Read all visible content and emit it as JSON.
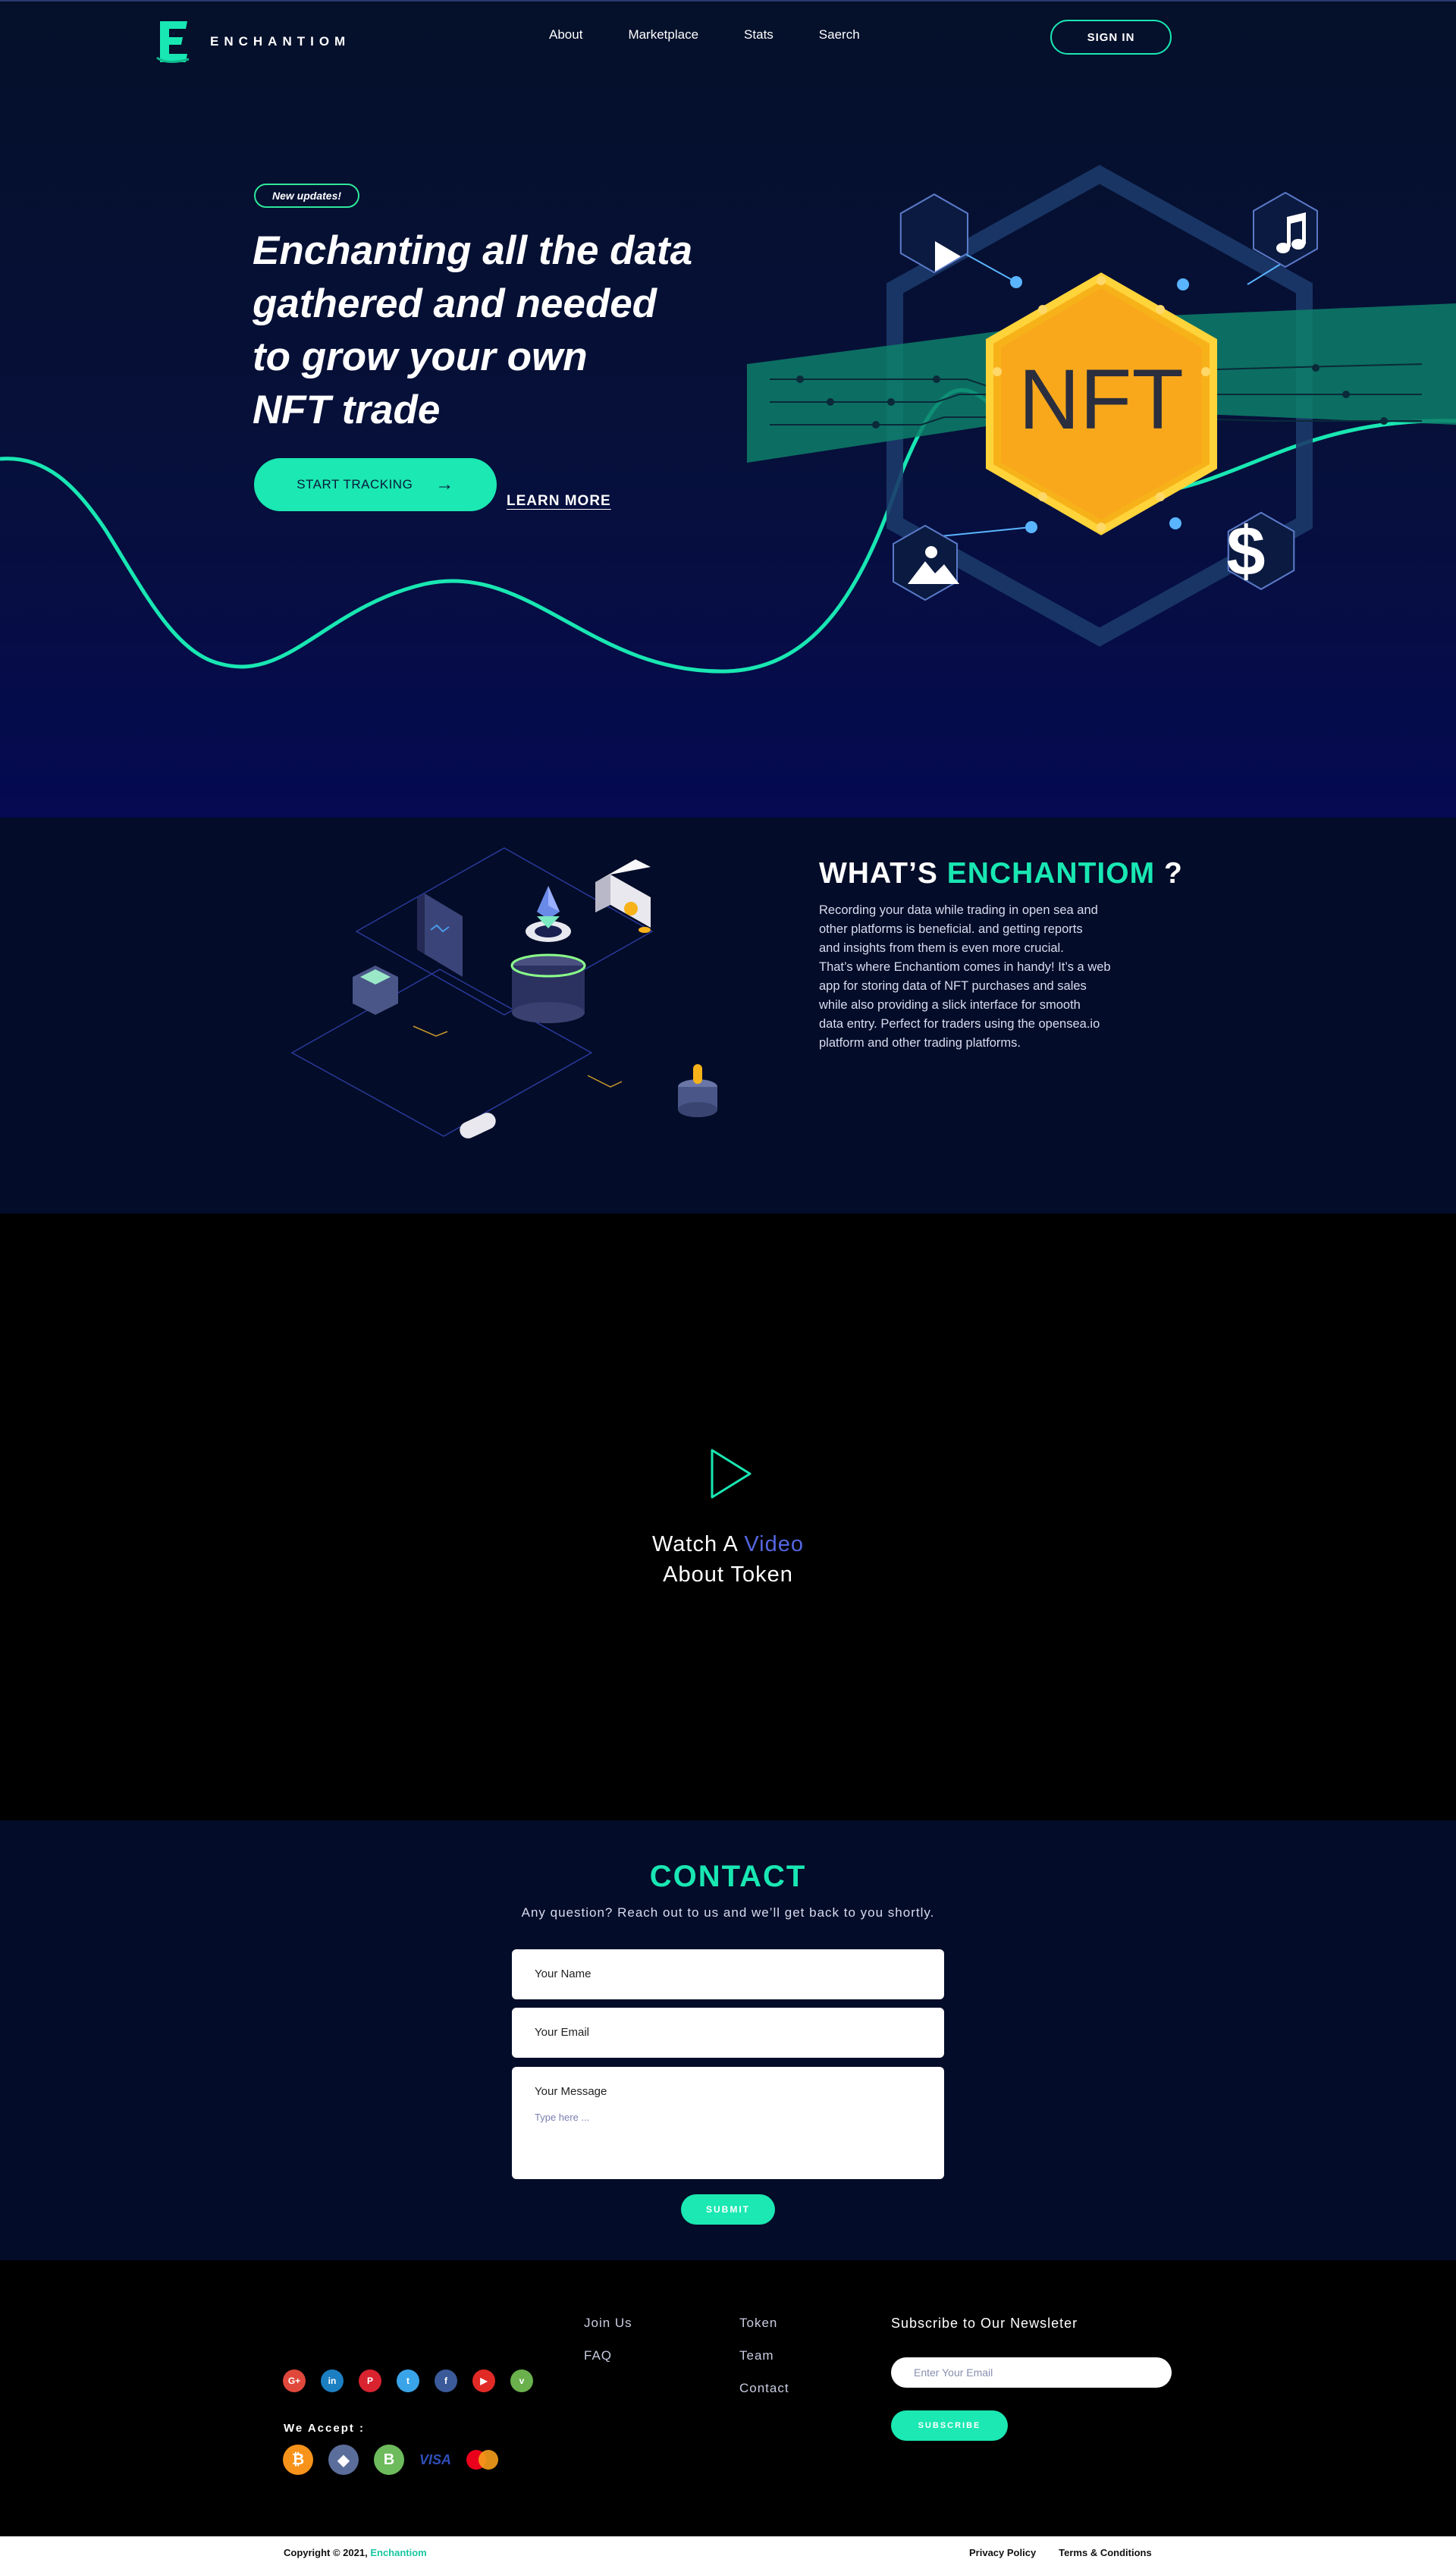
{
  "brand": {
    "name": "ENCHANTIOM",
    "accent_color": "#19e7b3"
  },
  "nav": {
    "links": [
      "About",
      "Marketplace",
      "Stats",
      "Saerch"
    ],
    "sign_in": "SIGN IN"
  },
  "hero": {
    "badge": "New updates!",
    "title_lines": [
      "Enchanting all the data",
      "gathered and needed",
      "to grow your own",
      "NFT trade"
    ],
    "cta_label": "START TRACKING",
    "learn_more": "LEARN MORE",
    "nft_label": "NFT"
  },
  "about": {
    "title_prefix": "WHAT’S",
    "title_accent": "ENCHANTIOM",
    "title_suffix": "?",
    "paragraph_lines": [
      "Recording your data while trading in open sea and",
      "other platforms is beneficial. and getting reports",
      "and insights from them is even more crucial.",
      "That’s where Enchantiom comes in handy! It’s a web",
      "app for storing data of NFT purchases and sales",
      "while also providing a slick interface for smooth",
      "data entry. Perfect for traders using the opensea.io",
      "platform and other trading platforms."
    ]
  },
  "video": {
    "line1_prefix": "Watch A",
    "line1_accent": "Video",
    "line2": "About Token"
  },
  "contact": {
    "title": "CONTACT",
    "subtitle": "Any question? Reach out to us and we’ll get back to you shortly.",
    "name_label": "Your Name",
    "email_label": "Your Email",
    "message_label": "Your Message",
    "message_placeholder": "Type here ...",
    "submit": "SUBMIT"
  },
  "footer": {
    "socials": [
      {
        "name": "google-plus-icon",
        "glyph": "G+",
        "color": "#e0483b"
      },
      {
        "name": "linkedin-icon",
        "glyph": "in",
        "color": "#1c7fc2"
      },
      {
        "name": "pinterest-icon",
        "glyph": "P",
        "color": "#d9232f"
      },
      {
        "name": "twitter-icon",
        "glyph": "t",
        "color": "#3aa4e8"
      },
      {
        "name": "facebook-icon",
        "glyph": "f",
        "color": "#3b5a9a"
      },
      {
        "name": "youtube-icon",
        "glyph": "▶",
        "color": "#e12a26"
      },
      {
        "name": "vine-icon",
        "glyph": "v",
        "color": "#6ab04c"
      }
    ],
    "we_accept": "We Accept :",
    "payments": [
      {
        "name": "bitcoin-icon",
        "glyph": "₿",
        "color": "#f7931a"
      },
      {
        "name": "ethereum-icon",
        "glyph": "◆",
        "color": "#5b6d9a"
      },
      {
        "name": "bitcoin-cash-icon",
        "glyph": "B",
        "color": "#6dbb5c"
      }
    ],
    "visa": "VISA",
    "col1": [
      "Join Us",
      "FAQ"
    ],
    "col2": [
      "Token",
      "Team",
      "Contact"
    ],
    "newsletter_title": "Subscribe to Our Newsleter",
    "newsletter_placeholder": "Enter Your Email",
    "subscribe": "SUBSCRIBE",
    "copyright_prefix": "Copyright © 2021,",
    "copyright_brand": "Enchantiom",
    "privacy": "Privacy Policy",
    "terms": "Terms & Conditions"
  }
}
